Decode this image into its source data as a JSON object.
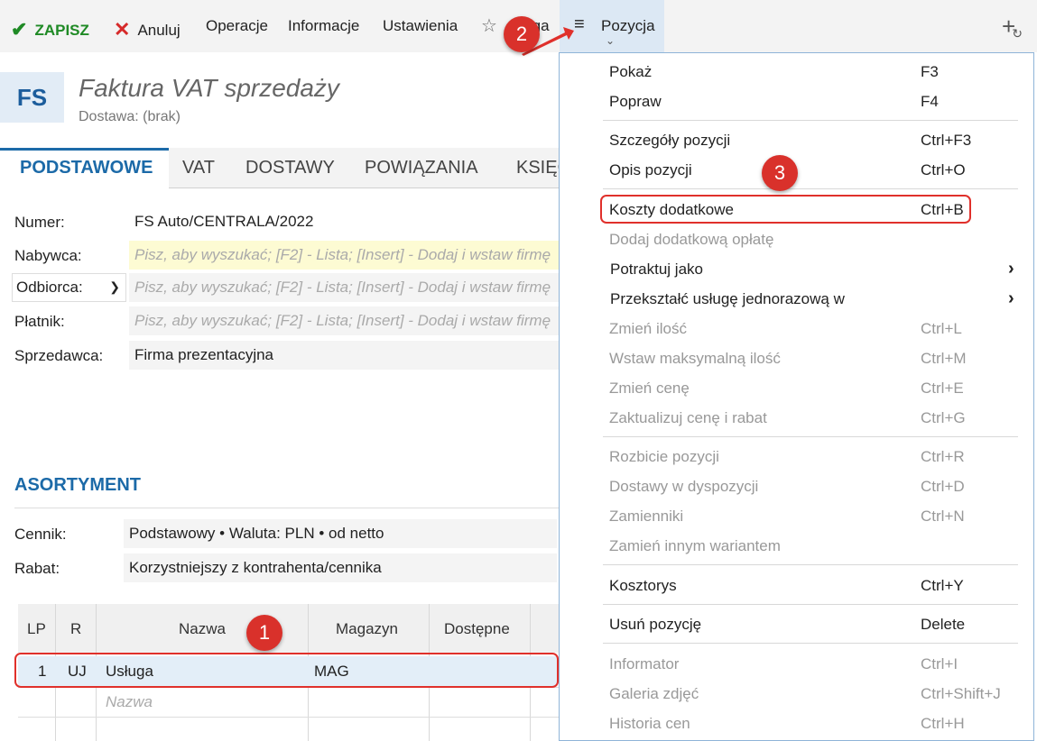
{
  "toolbar": {
    "save": "ZAPISZ",
    "cancel": "Anuluj",
    "operations": "Operacje",
    "information": "Informacje",
    "settings": "Ustawienia",
    "flag": "Flaga",
    "position": "Pozycja"
  },
  "document": {
    "badge": "FS",
    "title": "Faktura VAT sprzedaży",
    "subtitle": "Dostawa: (brak)"
  },
  "tabs": [
    "PODSTAWOWE",
    "VAT",
    "DOSTAWY",
    "POWIĄZANIA",
    "KSIĘG"
  ],
  "form": {
    "numer_label": "Numer:",
    "numer_value": "FS Auto/CENTRALA/2022",
    "nabywca_label": "Nabywca:",
    "nabywca_placeholder": "Pisz, aby wyszukać; [F2] - Lista; [Insert] - Dodaj i wstaw firmę",
    "odbiorca_label": "Odbiorca:",
    "odbiorca_placeholder": "Pisz, aby wyszukać; [F2] - Lista; [Insert] - Dodaj i wstaw firmę",
    "platnik_label": "Płatnik:",
    "platnik_placeholder": "Pisz, aby wyszukać; [F2] - Lista; [Insert] - Dodaj i wstaw firmę",
    "sprzedawca_label": "Sprzedawca:",
    "sprzedawca_value": "Firma prezentacyjna"
  },
  "assortment": {
    "title": "ASORTYMENT",
    "cennik_label": "Cennik:",
    "cennik_value": "Podstawowy • Waluta: PLN • od netto",
    "rabat_label": "Rabat:",
    "rabat_value": "Korzystniejszy z kontrahenta/cennika"
  },
  "grid": {
    "headers": [
      "LP",
      "R",
      "Nazwa",
      "Magazyn",
      "Dostępne"
    ],
    "rows": [
      {
        "lp": "1",
        "r": "UJ",
        "nazwa": "Usługa",
        "magazyn": "MAG"
      }
    ],
    "new_row_placeholder": "Nazwa"
  },
  "menu": {
    "items": [
      {
        "label": "Pokaż",
        "shortcut": "F3",
        "disabled": false
      },
      {
        "label": "Popraw",
        "shortcut": "F4",
        "disabled": false
      },
      {
        "label": "Szczegóły pozycji",
        "shortcut": "Ctrl+F3",
        "disabled": false
      },
      {
        "label": "Opis pozycji",
        "shortcut": "Ctrl+O",
        "disabled": false
      },
      {
        "label": "Koszty dodatkowe",
        "shortcut": "Ctrl+B",
        "disabled": false
      },
      {
        "label": "Dodaj dodatkową opłatę",
        "shortcut": "",
        "disabled": true
      },
      {
        "label": "Potraktuj jako",
        "shortcut": "",
        "disabled": false
      },
      {
        "label": "Przekształć usługę jednorazową w",
        "shortcut": "",
        "disabled": false
      },
      {
        "label": "Zmień ilość",
        "shortcut": "Ctrl+L",
        "disabled": true
      },
      {
        "label": "Wstaw maksymalną ilość",
        "shortcut": "Ctrl+M",
        "disabled": true
      },
      {
        "label": "Zmień cenę",
        "shortcut": "Ctrl+E",
        "disabled": true
      },
      {
        "label": "Zaktualizuj cenę i rabat",
        "shortcut": "Ctrl+G",
        "disabled": true
      },
      {
        "label": "Rozbicie pozycji",
        "shortcut": "Ctrl+R",
        "disabled": true
      },
      {
        "label": "Dostawy w dyspozycji",
        "shortcut": "Ctrl+D",
        "disabled": true
      },
      {
        "label": "Zamienniki",
        "shortcut": "Ctrl+N",
        "disabled": true
      },
      {
        "label": "Zamień innym wariantem",
        "shortcut": "",
        "disabled": true
      },
      {
        "label": "Kosztorys",
        "shortcut": "Ctrl+Y",
        "disabled": false
      },
      {
        "label": "Usuń pozycję",
        "shortcut": "Delete",
        "disabled": false
      },
      {
        "label": "Informator",
        "shortcut": "Ctrl+I",
        "disabled": true
      },
      {
        "label": "Galeria zdjęć",
        "shortcut": "Ctrl+Shift+J",
        "disabled": true
      },
      {
        "label": "Historia cen",
        "shortcut": "Ctrl+H",
        "disabled": true
      }
    ],
    "submenu_arrow": "›"
  },
  "markers": [
    "1",
    "2",
    "3"
  ],
  "colors": {
    "accent": "#1c6aa8",
    "save_green": "#1f8a25",
    "cancel_red": "#d62a2a",
    "highlight_red": "#e0302b",
    "selected_row": "#e3eef8",
    "menu_tab": "#dce8f4"
  },
  "icons": [
    "check-icon",
    "close-icon",
    "star-icon",
    "hamburger-icon",
    "chevron-down-icon",
    "add-refresh-icon",
    "chevron-right-icon"
  ]
}
